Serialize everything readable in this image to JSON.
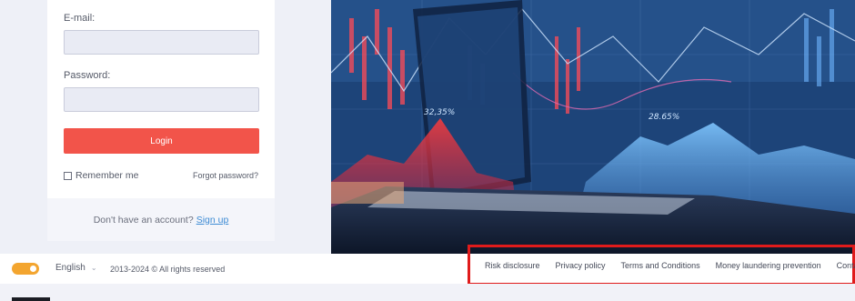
{
  "login": {
    "email_label": "E-mail:",
    "email_value": "",
    "password_label": "Password:",
    "password_value": "",
    "login_button": "Login",
    "remember_label": "Remember me",
    "forgot_link": "Forgot password?",
    "no_account_text": "Don't have an account?",
    "signup_link": "Sign up"
  },
  "hero": {
    "annotations": [
      "32,35%",
      "28.65%"
    ],
    "colors": {
      "primary_bg": "#1f4e8a",
      "accent_red": "#f2544a"
    }
  },
  "footer": {
    "language": "English",
    "copyright": "2013-2024 © All rights reserved",
    "links": [
      "Risk disclosure",
      "Privacy policy",
      "Terms and Conditions",
      "Money laundering prevention",
      "Contacts"
    ],
    "toggle_color": "#f3a52f"
  }
}
